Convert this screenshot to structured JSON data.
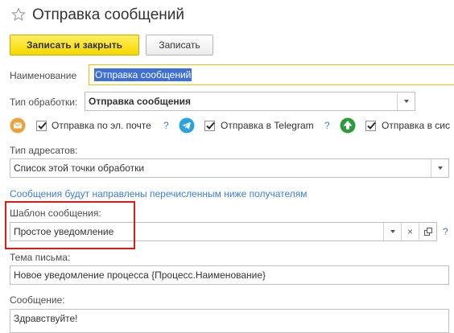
{
  "window": {
    "title": "Отправка сообщений"
  },
  "toolbar": {
    "save_close_label": "Записать и закрыть",
    "save_label": "Записать"
  },
  "form": {
    "name_label": "Наименование",
    "name_value": "Отправка сообщений",
    "processing_type_label": "Тип обработки:",
    "processing_type_value": "Отправка сообщения",
    "channels": [
      {
        "label": "Отправка по эл. почте",
        "help": "?",
        "checked": true,
        "icon": "envelope-icon"
      },
      {
        "label": "Отправка в Telegram",
        "help": "?",
        "checked": true,
        "icon": "telegram-icon"
      },
      {
        "label": "Отправка в сис",
        "checked": true,
        "icon": "up-arrow-icon"
      }
    ],
    "recipient_type_label": "Тип адресатов:",
    "recipient_type_value": "Список этой точки обработки",
    "recipients_note": "Сообщения будут направлены перечисленным ниже получателям",
    "template_label": "Шаблон сообщения:",
    "template_value": "Простое уведомление",
    "template_help": "?",
    "subject_label": "Тема письма:",
    "subject_value": "Новое уведомление процесса {Процесс.Наименование}",
    "message_label": "Сообщение:",
    "message_value": "Здравствуйте!"
  },
  "colors": {
    "primary_button": "#f6d700",
    "selection": "#3d6fd6",
    "link": "#3b7fd4",
    "highlight_frame": "#e01919",
    "envelope_icon": "#e8a33c",
    "telegram_icon": "#2aa3df",
    "green_icon": "#2e9a3e"
  }
}
